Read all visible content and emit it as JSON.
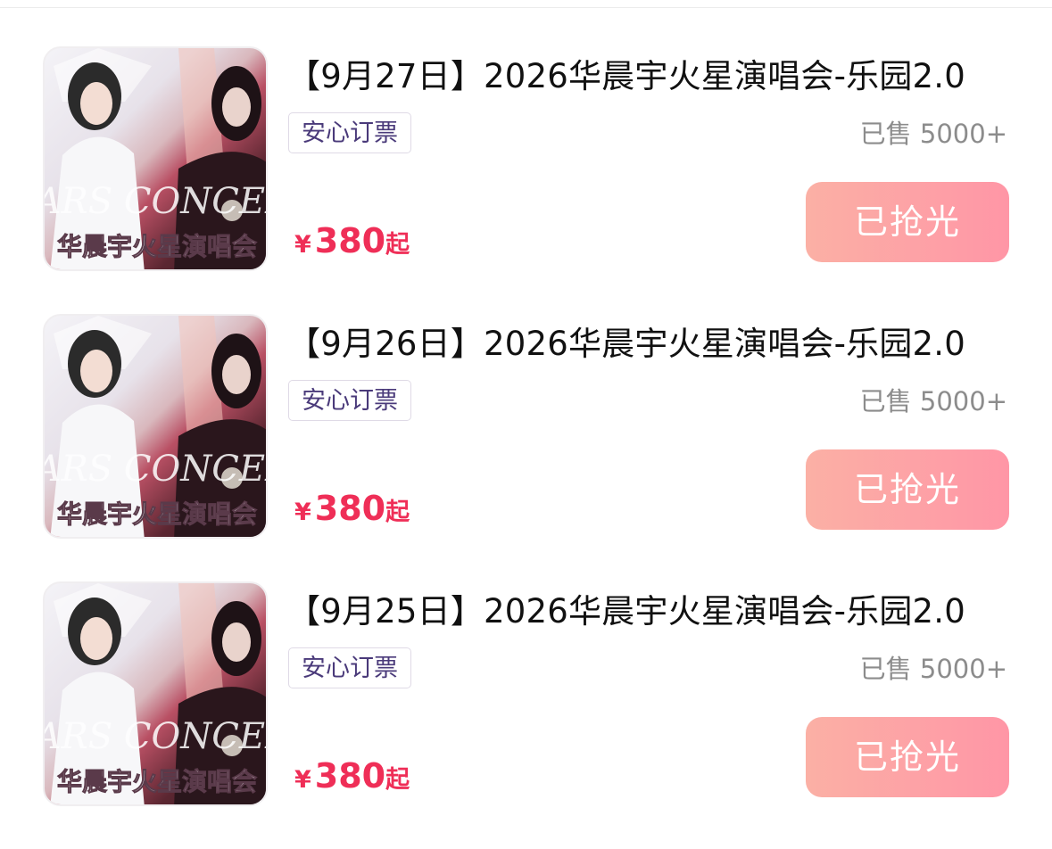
{
  "events": [
    {
      "title": "【9月27日】2026华晨宇火星演唱会-乐园2.0",
      "tag": "安心订票",
      "sold": "已售 5000+",
      "price_currency": "¥",
      "price_amount": "380",
      "price_suffix": "起",
      "button_label": "已抢光"
    },
    {
      "title": "【9月26日】2026华晨宇火星演唱会-乐园2.0",
      "tag": "安心订票",
      "sold": "已售 5000+",
      "price_currency": "¥",
      "price_amount": "380",
      "price_suffix": "起",
      "button_label": "已抢光"
    },
    {
      "title": "【9月25日】2026华晨宇火星演唱会-乐园2.0",
      "tag": "安心订票",
      "sold": "已售 5000+",
      "price_currency": "¥",
      "price_amount": "380",
      "price_suffix": "起",
      "button_label": "已抢光"
    }
  ],
  "poster": {
    "headline": "MARS CONCERT",
    "caption": "华晨宇火星演唱会"
  },
  "colors": {
    "price": "#ef2e57",
    "button_start": "#fbb0a5",
    "button_end": "#ff96a6",
    "tag_text": "#4a3a7a",
    "sold_text": "#8c8c8c"
  }
}
